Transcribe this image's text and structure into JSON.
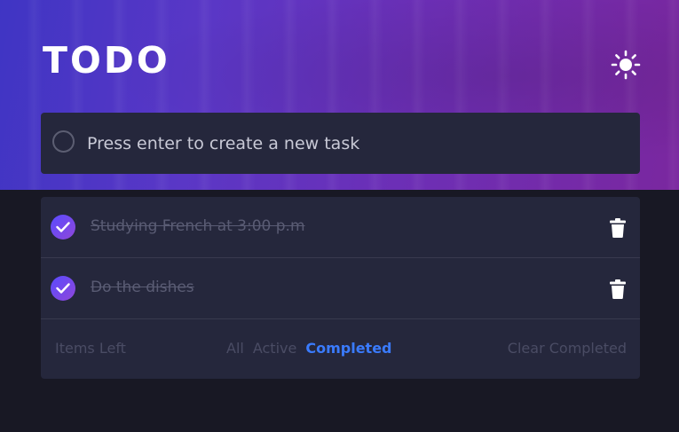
{
  "header": {
    "title": "TODO",
    "theme_icon": "sun-icon"
  },
  "new_task": {
    "placeholder": "Press enter to create a new task",
    "value": ""
  },
  "tasks": [
    {
      "text": "Studying French at 3:00 p.m",
      "completed": true
    },
    {
      "text": "Do the dishes",
      "completed": true
    }
  ],
  "footer": {
    "items_left": "Items Left",
    "filters": [
      "All",
      "Active",
      "Completed"
    ],
    "selected_filter": "Completed",
    "clear_label": "Clear Completed"
  },
  "colors": {
    "accent": "#3a7bfd",
    "check_gradient_start": "#5a4bff",
    "check_gradient_end": "#8f47d9",
    "card": "#25273c",
    "background": "#181824"
  }
}
